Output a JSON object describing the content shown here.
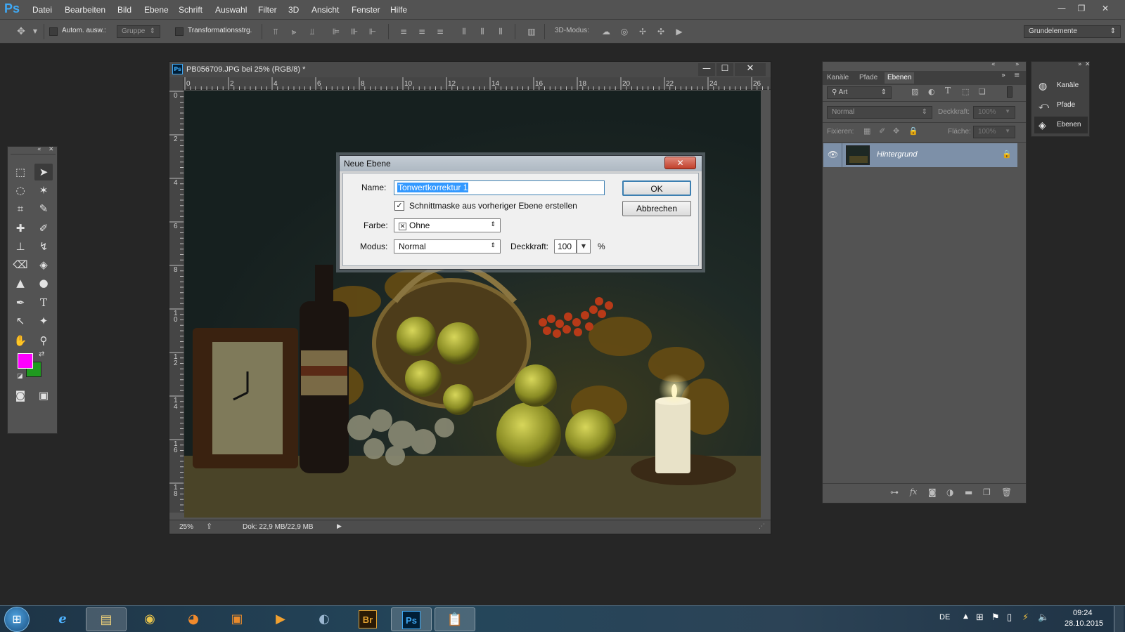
{
  "menubar": {
    "logo": "Ps",
    "items": [
      "Datei",
      "Bearbeiten",
      "Bild",
      "Ebene",
      "Schrift",
      "Auswahl",
      "Filter",
      "3D",
      "Ansicht",
      "Fenster",
      "Hilfe"
    ]
  },
  "optionsbar": {
    "auto_select_label": "Autom. ausw.:",
    "group_select": "Gruppe",
    "transform_label": "Transformationsstrg.",
    "mode3d_label": "3D-Modus:",
    "workspace_select": "Grundelemente"
  },
  "document": {
    "title": "PB056709.JPG bei 25% (RGB/8) *",
    "ruler_top": [
      "0",
      "2",
      "4",
      "6",
      "8",
      "10",
      "12",
      "14",
      "16",
      "18",
      "20",
      "22",
      "24",
      "26"
    ],
    "ruler_left": [
      "0",
      "2",
      "4",
      "6",
      "8",
      "1\n0",
      "1\n2",
      "1\n4",
      "1\n6",
      "1\n8"
    ],
    "zoom": "25%",
    "doc_info": "Dok: 22,9 MB/22,9 MB"
  },
  "dialog": {
    "title": "Neue Ebene",
    "name_label": "Name:",
    "name_value": "Tonwertkorrektur 1",
    "clip_mask_label": "Schnittmaske aus vorheriger Ebene erstellen",
    "clip_mask_checked": true,
    "color_label": "Farbe:",
    "color_value": "Ohne",
    "mode_label": "Modus:",
    "mode_value": "Normal",
    "opacity_label": "Deckkraft:",
    "opacity_value": "100",
    "opacity_unit": "%",
    "ok_label": "OK",
    "cancel_label": "Abbrechen",
    "close_glyph": "✕"
  },
  "layers_panel": {
    "tabs": [
      "Kanäle",
      "Pfade",
      "Ebenen"
    ],
    "filter_select": "Art",
    "blend_mode": "Normal",
    "opacity_label": "Deckkraft:",
    "opacity_value": "100%",
    "lock_label": "Fixieren:",
    "fill_label": "Fläche:",
    "fill_value": "100%",
    "layer_name": "Hintergrund"
  },
  "minidock": {
    "items": [
      "Kanäle",
      "Pfade",
      "Ebenen"
    ]
  },
  "colors": {
    "foreground": "#ff00ff",
    "background": "#1f9a1f",
    "accent": "#3fa9f5"
  },
  "taskbar": {
    "apps": [
      "windows-start",
      "internet-explorer",
      "file-explorer",
      "chrome",
      "firefox",
      "app-box",
      "media-player",
      "globe-app",
      "bridge",
      "photoshop",
      "clipboard-app"
    ],
    "bridge_label": "Br",
    "photoshop_label": "Ps",
    "language": "DE",
    "time": "09:24",
    "date": "28.10.2015"
  }
}
